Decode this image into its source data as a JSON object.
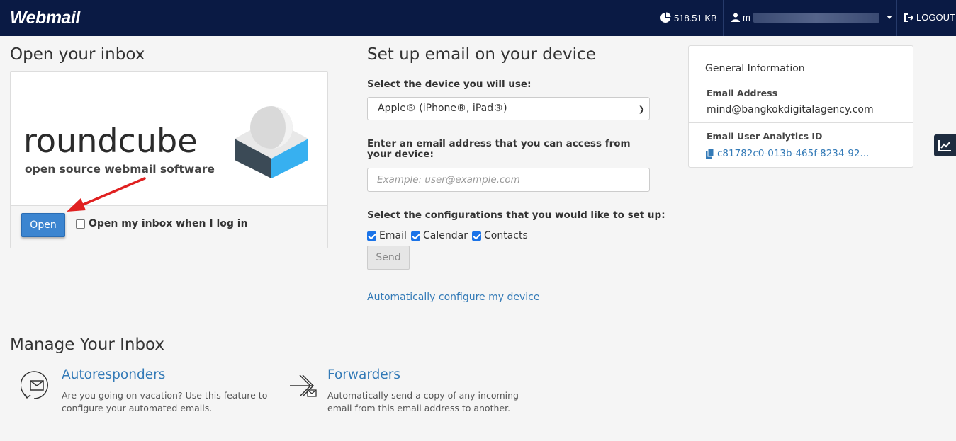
{
  "topbar": {
    "logo": "Webmail",
    "disk_usage": "518.51 KB",
    "user_initial": "m",
    "logout_label": "LOGOUT"
  },
  "open_inbox": {
    "heading": "Open your inbox",
    "logo_wordmark": "roundcube",
    "logo_tagline": "open source webmail software",
    "open_button": "Open",
    "open_on_login_label": "Open my inbox when I log in",
    "open_on_login_checked": false
  },
  "setup": {
    "heading": "Set up email on your device",
    "device_label": "Select the device you will use:",
    "device_selected": "Apple® (iPhone®, iPad®)",
    "email_label": "Enter an email address that you can access from your device:",
    "email_placeholder": "Example: user@example.com",
    "config_label": "Select the configurations that you would like to set up:",
    "options": [
      {
        "label": "Email",
        "checked": true
      },
      {
        "label": "Calendar",
        "checked": true
      },
      {
        "label": "Contacts",
        "checked": true
      }
    ],
    "send_button": "Send",
    "auto_config_link": "Automatically configure my device"
  },
  "general_info": {
    "heading": "General Information",
    "email_address_label": "Email Address",
    "email_address": "mind@bangkokdigitalagency.com",
    "analytics_id_label": "Email User Analytics ID",
    "analytics_id": "c81782c0-013b-465f-8234-92..."
  },
  "manage": {
    "heading": "Manage Your Inbox",
    "autoresponders_title": "Autoresponders",
    "autoresponders_desc_1": "Are you going on vacation? Use this feature to",
    "autoresponders_desc_2": "configure your automated emails.",
    "forwarders_title": "Forwarders",
    "forwarders_desc_1": "Automatically send a copy of any incoming",
    "forwarders_desc_2": "email from this email address to another."
  },
  "colors": {
    "topbar": "#0a1a44",
    "link": "#337ab7",
    "primary_button": "#3c85d0",
    "annotation_arrow": "#e02020"
  }
}
